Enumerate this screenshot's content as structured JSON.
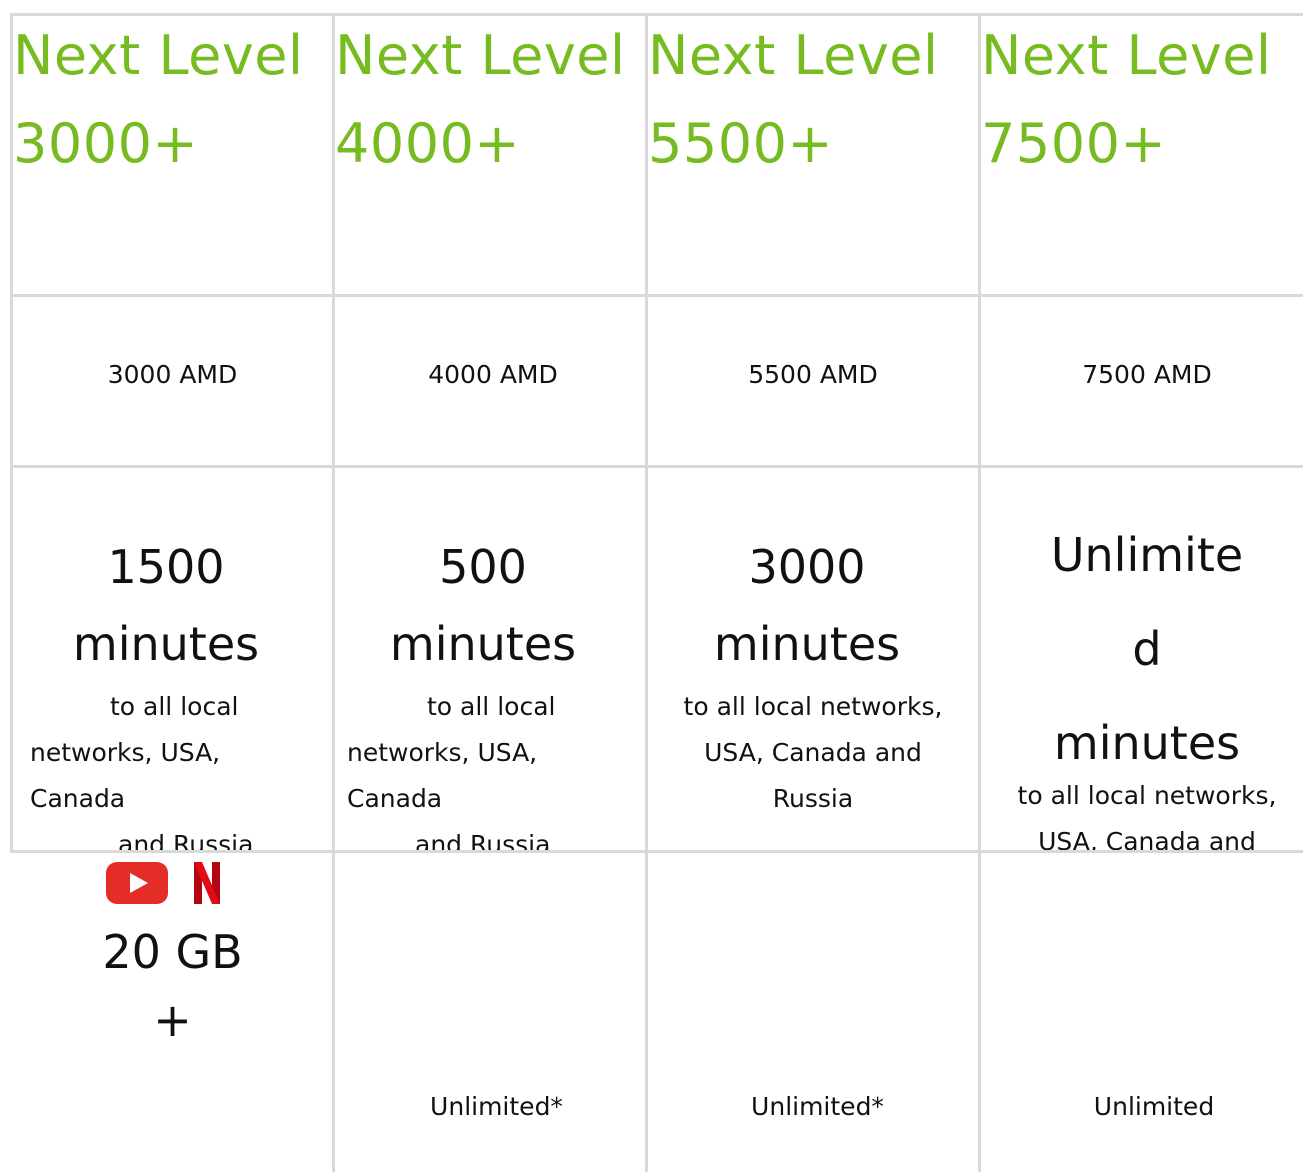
{
  "plans": [
    {
      "title": "Next Level\n3000+",
      "price": "3000 AMD",
      "minutes_big": "1500\nminutes",
      "minutes_desc_lines": [
        "to all local",
        "networks, USA,",
        "Canada",
        "and Russia"
      ],
      "data_main": "20 GB",
      "data_plus": "+",
      "data_text": ""
    },
    {
      "title": "Next Level\n4000+",
      "price": "4000 AMD",
      "minutes_big": "500\nminutes",
      "minutes_desc_lines": [
        "to all local",
        "networks, USA,",
        "Canada",
        "and Russia"
      ],
      "data_main": "",
      "data_plus": "",
      "data_text": "Unlimited*"
    },
    {
      "title": "Next Level\n5500+",
      "price": "5500 AMD",
      "minutes_big": "3000\nminutes",
      "minutes_desc_lines": [
        "to all local networks,",
        "USA,  Canada and",
        "Russia"
      ],
      "data_main": "",
      "data_plus": "",
      "data_text": "Unlimited*"
    },
    {
      "title": "Next Level\n7500+",
      "price": "7500 AMD",
      "minutes_big": "Unlimite\nd\nminutes",
      "minutes_desc_lines": [
        "to all local networks,",
        "USA,  Canada and"
      ],
      "data_main": "",
      "data_plus": "",
      "data_text": "Unlimited"
    }
  ],
  "icons": [
    "youtube-icon",
    "netflix-icon"
  ],
  "colors": {
    "title_green": "#76bc21",
    "grid": "#d9d9d9",
    "youtube_red": "#e52d27",
    "netflix_red": "#e50914"
  }
}
